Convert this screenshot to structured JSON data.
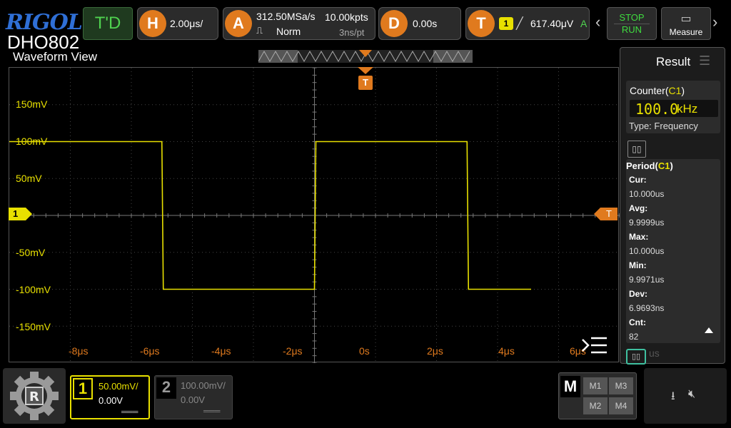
{
  "brand": {
    "logo": "RIGOL",
    "model": "DHO802"
  },
  "topbar": {
    "trigger_status": "T'D",
    "horizontal": {
      "letter": "H",
      "timebase": "2.00μs/"
    },
    "acquire": {
      "letter": "A",
      "sample_rate": "312.50MSa/s",
      "memory": "10.00kpts",
      "mode": "Norm",
      "resolution": "3ns/pt"
    },
    "delay": {
      "letter": "D",
      "value": "0.00s"
    },
    "trigger": {
      "letter": "T",
      "source": "1",
      "level": "617.40μV",
      "coupling": "A"
    },
    "stop_label": "STOP",
    "run_label": "RUN",
    "measure_label": "Measure"
  },
  "waveform": {
    "title": "Waveform View",
    "trigger_marker": "T",
    "channel_marker": "1",
    "level_marker": "T",
    "y_labels": [
      "150mV",
      "100mV",
      "50mV",
      "-50mV",
      "-100mV",
      "-150mV"
    ],
    "x_labels": [
      "-8μs",
      "-6μs",
      "-4μs",
      "-2μs",
      "0s",
      "2μs",
      "4μs",
      "6μs"
    ],
    "signal": {
      "high_mV": 100,
      "low_mV": -100,
      "period_us": 10,
      "rising_edge_us": 0,
      "falling_edges_us": [
        -5,
        5
      ],
      "color": "#e8e000"
    }
  },
  "result": {
    "title": "Result",
    "counter": {
      "label": "Counter",
      "channel": "C1",
      "value": "100.0",
      "unit": "kHz",
      "type_label": "Type:",
      "type_value": "Frequency"
    },
    "period": {
      "label": "Period",
      "channel": "C1",
      "rows": [
        {
          "label": "Cur:",
          "value": "10.000us"
        },
        {
          "label": "Avg:",
          "value": "9.9999us"
        },
        {
          "label": "Max:",
          "value": "10.000us"
        },
        {
          "label": "Min:",
          "value": "9.9971us"
        },
        {
          "label": "Dev:",
          "value": "6.9693ns"
        },
        {
          "label": "Cnt:",
          "value": "82"
        }
      ]
    },
    "partial_text": "us"
  },
  "bottom": {
    "ch1": {
      "num": "1",
      "scale": "50.00mV/",
      "offset": "0.00V",
      "color": "#e8e000"
    },
    "ch2": {
      "num": "2",
      "scale": "100.00mV/",
      "offset": "0.00V"
    },
    "math": {
      "label": "M",
      "items": [
        "M1",
        "M3",
        "M2",
        "M4"
      ]
    }
  }
}
